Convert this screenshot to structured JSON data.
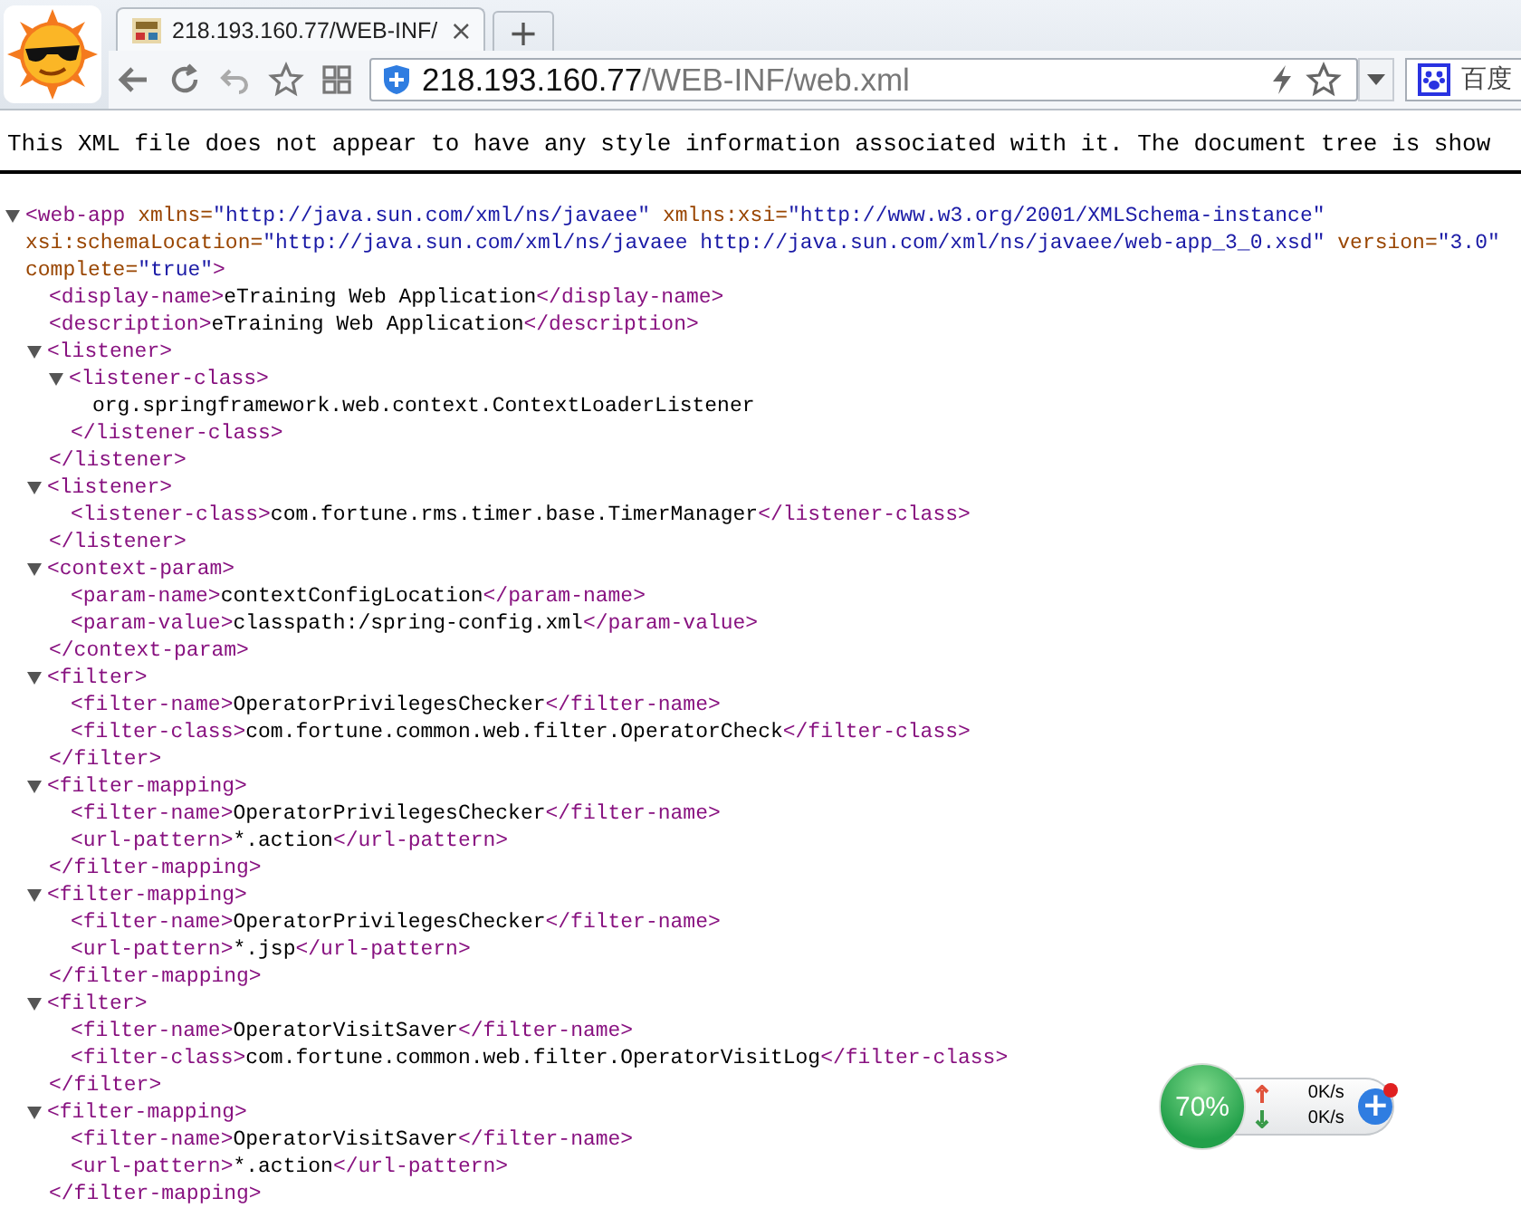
{
  "browser": {
    "tabs": [
      {
        "title": "218.193.160.77/WEB-INF/",
        "close": "×",
        "selected": true
      }
    ],
    "new_tab": "+",
    "url_host": "218.193.160.77",
    "url_path": "/WEB-INF/web.xml",
    "search_label": "百度"
  },
  "notice": "This XML file does not appear to have any style information associated with it. The document tree is show",
  "xml": {
    "kind": "element",
    "expanded": true,
    "open_start": "<web-app",
    "attrs": [
      {
        "name": "xmlns=",
        "value": "\"http://java.sun.com/xml/ns/javaee\""
      },
      {
        "name": "xmlns:xsi=",
        "value": "\"http://www.w3.org/2001/XMLSchema-instance\""
      },
      {
        "name": "xsi:schemaLocation=",
        "value": "\"http://java.sun.com/xml/ns/javaee http://java.sun.com/xml/ns/javaee/web-app_3_0.xsd\""
      },
      {
        "name": "version=",
        "value": "\"3.0\""
      },
      {
        "name": "complete=",
        "value": "\"true\""
      }
    ],
    "open_end": ">",
    "children": [
      {
        "kind": "leaf",
        "open": "<display-name>",
        "text": "eTraining Web Application",
        "close": "</display-name>"
      },
      {
        "kind": "leaf",
        "open": "<description>",
        "text": "eTraining Web Application",
        "close": "</description>"
      },
      {
        "kind": "element",
        "expanded": true,
        "open_start": "<listener",
        "open_end": ">",
        "close": "</listener>",
        "children": [
          {
            "kind": "element",
            "expanded": true,
            "open_start": "<listener-class",
            "open_end": ">",
            "close": "</listener-class>",
            "children": [
              {
                "kind": "text",
                "text": "org.springframework.web.context.ContextLoaderListener"
              }
            ]
          }
        ]
      },
      {
        "kind": "element",
        "expanded": true,
        "open_start": "<listener",
        "open_end": ">",
        "close": "</listener>",
        "children": [
          {
            "kind": "leaf",
            "open": "<listener-class>",
            "text": "com.fortune.rms.timer.base.TimerManager",
            "close": "</listener-class>"
          }
        ]
      },
      {
        "kind": "element",
        "expanded": true,
        "open_start": "<context-param",
        "open_end": ">",
        "close": "</context-param>",
        "children": [
          {
            "kind": "leaf",
            "open": "<param-name>",
            "text": "contextConfigLocation",
            "close": "</param-name>"
          },
          {
            "kind": "leaf",
            "open": "<param-value>",
            "text": "classpath:/spring-config.xml",
            "close": "</param-value>"
          }
        ]
      },
      {
        "kind": "element",
        "expanded": true,
        "open_start": "<filter",
        "open_end": ">",
        "close": "</filter>",
        "children": [
          {
            "kind": "leaf",
            "open": "<filter-name>",
            "text": "OperatorPrivilegesChecker",
            "close": "</filter-name>"
          },
          {
            "kind": "leaf",
            "open": "<filter-class>",
            "text": "com.fortune.common.web.filter.OperatorCheck",
            "close": "</filter-class>"
          }
        ]
      },
      {
        "kind": "element",
        "expanded": true,
        "open_start": "<filter-mapping",
        "open_end": ">",
        "close": "</filter-mapping>",
        "children": [
          {
            "kind": "leaf",
            "open": "<filter-name>",
            "text": "OperatorPrivilegesChecker",
            "close": "</filter-name>"
          },
          {
            "kind": "leaf",
            "open": "<url-pattern>",
            "text": "*.action",
            "close": "</url-pattern>"
          }
        ]
      },
      {
        "kind": "element",
        "expanded": true,
        "open_start": "<filter-mapping",
        "open_end": ">",
        "close": "</filter-mapping>",
        "children": [
          {
            "kind": "leaf",
            "open": "<filter-name>",
            "text": "OperatorPrivilegesChecker",
            "close": "</filter-name>"
          },
          {
            "kind": "leaf",
            "open": "<url-pattern>",
            "text": "*.jsp",
            "close": "</url-pattern>"
          }
        ]
      },
      {
        "kind": "element",
        "expanded": true,
        "open_start": "<filter",
        "open_end": ">",
        "close": "</filter>",
        "children": [
          {
            "kind": "leaf",
            "open": "<filter-name>",
            "text": "OperatorVisitSaver",
            "close": "</filter-name>"
          },
          {
            "kind": "leaf",
            "open": "<filter-class>",
            "text": "com.fortune.common.web.filter.OperatorVisitLog",
            "close": "</filter-class>"
          }
        ]
      },
      {
        "kind": "element",
        "expanded": true,
        "open_start": "<filter-mapping",
        "open_end": ">",
        "close": "</filter-mapping>",
        "children": [
          {
            "kind": "leaf",
            "open": "<filter-name>",
            "text": "OperatorVisitSaver",
            "close": "</filter-name>"
          },
          {
            "kind": "leaf",
            "open": "<url-pattern>",
            "text": "*.action",
            "close": "</url-pattern>"
          }
        ]
      }
    ]
  },
  "speed_widget": {
    "memory": "70%",
    "upload": "0K/s",
    "download": "0K/s",
    "plus": "+",
    "alert": true
  }
}
